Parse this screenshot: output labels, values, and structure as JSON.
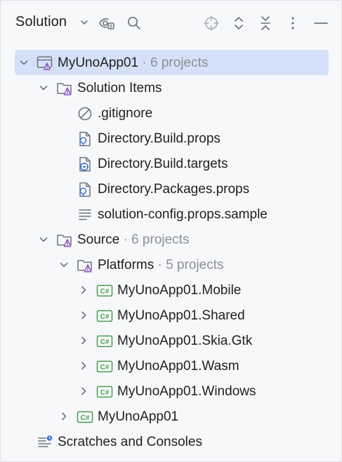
{
  "toolbar": {
    "title": "Solution",
    "icons": [
      "chevron-down-icon",
      "eye-settings-icon",
      "search-icon",
      "locate-icon",
      "expand-all-icon",
      "collapse-all-icon",
      "more-vertical-icon",
      "minimize-icon"
    ]
  },
  "tree": {
    "root": {
      "label": "MyUnoApp01",
      "meta": " · 6 projects"
    },
    "solution_items": {
      "label": "Solution Items",
      "files": [
        {
          "label": ".gitignore",
          "icon": "ignore-file-icon"
        },
        {
          "label": "Directory.Build.props",
          "icon": "props-file-icon"
        },
        {
          "label": "Directory.Build.targets",
          "icon": "targets-file-icon"
        },
        {
          "label": "Directory.Packages.props",
          "icon": "props-file-icon"
        },
        {
          "label": "solution-config.props.sample",
          "icon": "text-file-icon"
        }
      ]
    },
    "source": {
      "label": "Source",
      "meta": " · 6 projects"
    },
    "platforms": {
      "label": "Platforms",
      "meta": " · 5 projects"
    },
    "projects": [
      {
        "label": "MyUnoApp01.Mobile"
      },
      {
        "label": "MyUnoApp01.Shared"
      },
      {
        "label": "MyUnoApp01.Skia.Gtk"
      },
      {
        "label": "MyUnoApp01.Wasm"
      },
      {
        "label": "MyUnoApp01.Windows"
      }
    ],
    "main_project": {
      "label": "MyUnoApp01"
    },
    "scratches": {
      "label": "Scratches and Consoles"
    },
    "csharp_badge": "C#"
  },
  "colors": {
    "selection": "#d5e1f8",
    "folder_accent": "#8a55d6",
    "csharp_green": "#3b9e48",
    "meta_text": "#8c8f94",
    "icon_gray": "#6f737a"
  }
}
